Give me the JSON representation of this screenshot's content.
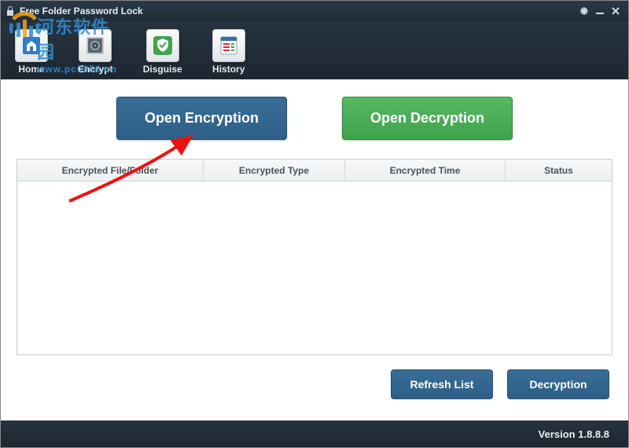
{
  "title": "Free Folder Password Lock",
  "nav": {
    "home": "Home",
    "encrypt": "Encrypt",
    "disguise": "Disguise",
    "history": "History"
  },
  "actions": {
    "open_encryption": "Open Encryption",
    "open_decryption": "Open Decryption",
    "refresh_list": "Refresh List",
    "decryption": "Decryption"
  },
  "table": {
    "col_file": "Encrypted File/Folder",
    "col_type": "Encrypted Type",
    "col_time": "Encrypted Time",
    "col_status": "Status"
  },
  "version_label": "Version 1.8.8.8",
  "watermark": {
    "text": "河东软件园",
    "url": "www.pc0359.cn"
  }
}
